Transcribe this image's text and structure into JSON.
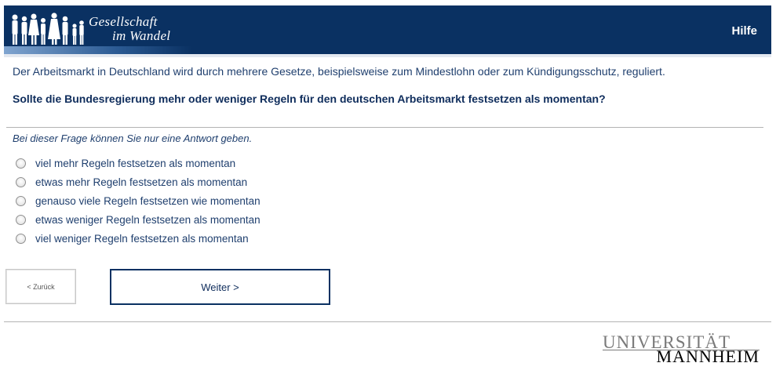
{
  "header": {
    "logo_line1": "Gesellschaft",
    "logo_line2": "im Wandel",
    "help_label": "Hilfe"
  },
  "intro_text": "Der Arbeitsmarkt in Deutschland wird durch mehrere Gesetze, beispielsweise zum Mindestlohn oder zum Kündigungsschutz, reguliert.",
  "question_text": "Sollte die Bundesregierung mehr oder weniger Regeln für den deutschen Arbeitsmarkt festsetzen als momentan?",
  "hint_text": "Bei dieser Frage können Sie nur eine Antwort geben.",
  "options": [
    "viel mehr Regeln festsetzen als momentan",
    "etwas mehr Regeln festsetzen als momentan",
    "genauso viele Regeln festsetzen wie momentan",
    "etwas weniger Regeln festsetzen als momentan",
    "viel weniger Regeln festsetzen als momentan"
  ],
  "nav": {
    "back_label": "< Zurück",
    "next_label": "Weiter >"
  },
  "footer": {
    "uni_line1": "UNIVERSITÄT",
    "uni_line2": "MANNHEIM"
  },
  "colors": {
    "header_bg": "#0a3162",
    "text": "#1f3f6e"
  }
}
